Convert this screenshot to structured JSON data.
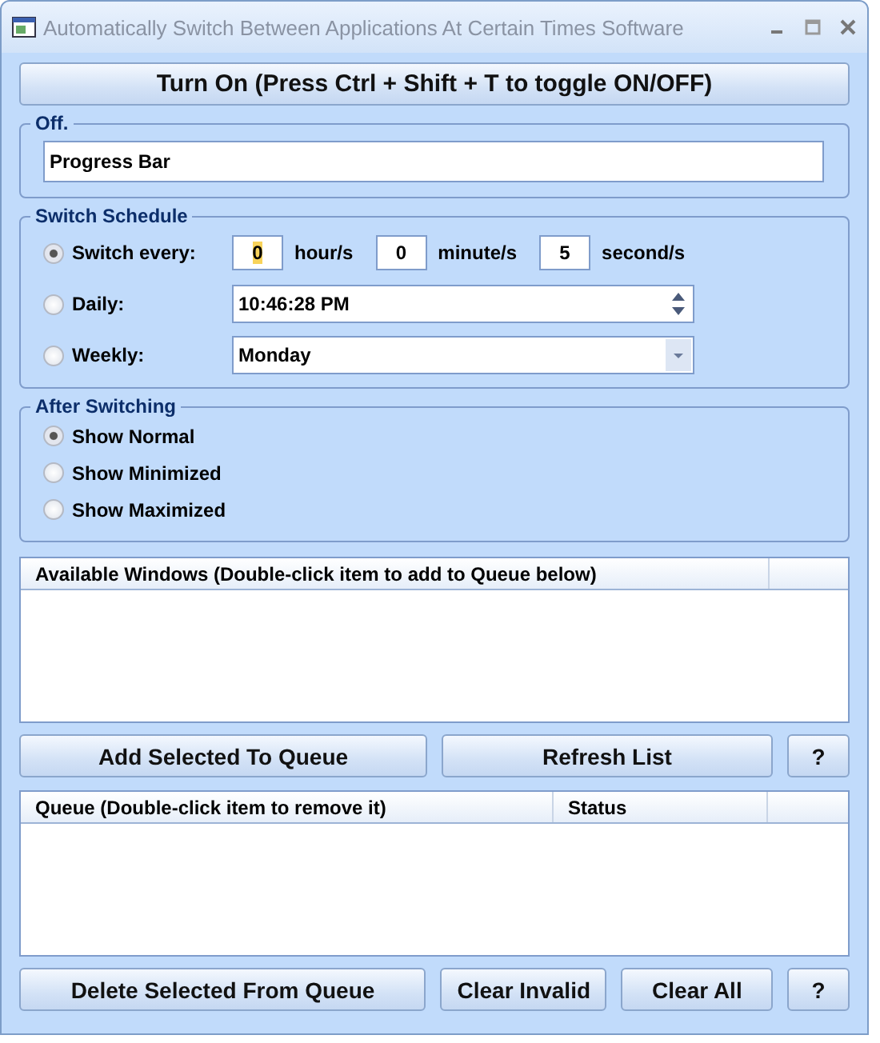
{
  "window": {
    "title": "Automatically Switch Between Applications At Certain Times Software"
  },
  "toggle_button": "Turn On (Press Ctrl + Shift + T to toggle ON/OFF)",
  "status_group": {
    "legend": "Off.",
    "value": "Progress Bar"
  },
  "schedule": {
    "legend": "Switch Schedule",
    "options": [
      {
        "kind": "interval",
        "label": "Switch every:",
        "selected": true,
        "fields": [
          {
            "value": "0",
            "unit": "hour/s",
            "text_selected": true
          },
          {
            "value": "0",
            "unit": "minute/s",
            "text_selected": false
          },
          {
            "value": "5",
            "unit": "second/s",
            "text_selected": false
          }
        ]
      },
      {
        "kind": "time",
        "label": "Daily:",
        "selected": false,
        "value": "10:46:28 PM"
      },
      {
        "kind": "dropdown",
        "label": "Weekly:",
        "selected": false,
        "value": "Monday"
      }
    ]
  },
  "after_switching": {
    "legend": "After Switching",
    "options": [
      {
        "label": "Show Normal",
        "selected": true
      },
      {
        "label": "Show Minimized",
        "selected": false
      },
      {
        "label": "Show Maximized",
        "selected": false
      }
    ]
  },
  "available_list": {
    "columns": [
      "Available Windows (Double-click item to add to Queue below)"
    ]
  },
  "available_buttons": [
    "Add Selected To Queue",
    "Refresh List",
    "?"
  ],
  "queue_list": {
    "columns": [
      "Queue (Double-click item to remove it)",
      "Status"
    ]
  },
  "queue_buttons": [
    "Delete Selected From Queue",
    "Clear Invalid",
    "Clear All",
    "?"
  ]
}
